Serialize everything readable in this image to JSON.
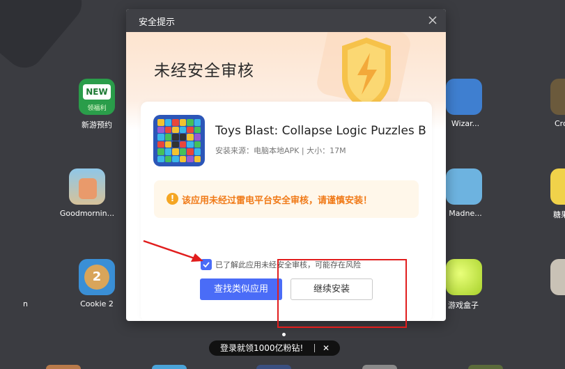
{
  "desktop": {
    "icons": [
      {
        "label": "新游预约",
        "badge": "NEW",
        "badge_sub": "领福利"
      },
      {
        "label": "Goodmornin..."
      },
      {
        "label": "Cookie 2",
        "number": "2"
      },
      {
        "label": "Wizar..."
      },
      {
        "label": "Madne..."
      },
      {
        "label": "Cro"
      },
      {
        "label": "糖果"
      },
      {
        "label": "游戏盒子"
      },
      {
        "label": "n"
      }
    ]
  },
  "dialog": {
    "title": "安全提示",
    "heading": "未经安全审核",
    "app_name": "Toys Blast: Collapse Logic Puzzles B",
    "app_meta": "安装来源：电脑本地APK | 大小：17M",
    "warning": "该应用未经过雷电平台安全审核，请谨慎安装！",
    "acknowledge_label": "已了解此应用未经安全审核，可能存在风险",
    "acknowledge_checked": true,
    "find_similar_label": "查找类似应用",
    "continue_label": "继续安装"
  },
  "promo": {
    "text": "登录就领1000亿粉钻!",
    "close": "✕"
  },
  "colors": {
    "accent": "#4a6cf7",
    "warning_text": "#f07a18",
    "annotation": "#e11d1d"
  }
}
